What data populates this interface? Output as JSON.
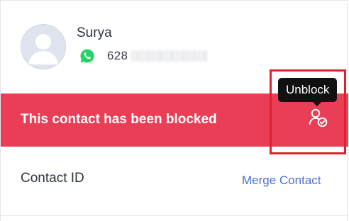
{
  "contact": {
    "name": "Surya",
    "phone_prefix": "628",
    "channel_icon": "whatsapp-icon",
    "avatar_icon": "user-avatar-icon"
  },
  "banner": {
    "text": "This contact has been blocked",
    "background_color": "#ea3d56",
    "action_icon": "user-check-icon"
  },
  "tooltip": {
    "text": "Unblock"
  },
  "details": {
    "contact_id_label": "Contact ID",
    "merge_link_label": "Merge Contact",
    "link_color": "#4b6fd4"
  },
  "colors": {
    "whatsapp_green": "#25d366",
    "highlight_red": "#e0202c"
  }
}
